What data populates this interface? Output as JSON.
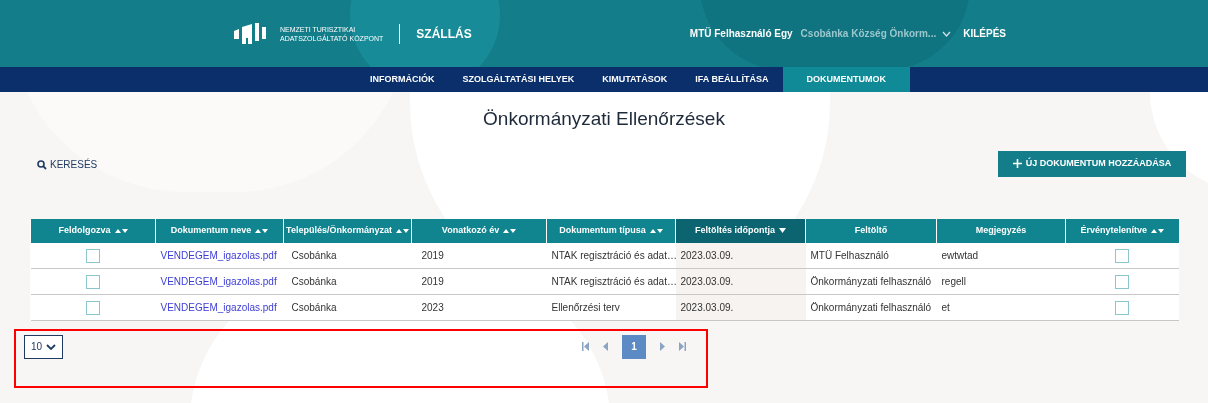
{
  "header": {
    "logo_line_1": "NEMZETI TURISZTIKAI",
    "logo_line_2": "ADATSZOLGÁLTATÓ KÖZPONT",
    "app_name": "SZÁLLÁS",
    "user": "MTÜ Felhasználó Egy",
    "organization": "Csobánka Község Önkorm...",
    "logout": "KILÉPÉS"
  },
  "nav": [
    {
      "label": "INFORMÁCIÓK",
      "selected": false
    },
    {
      "label": "SZOLGÁLTATÁSI HELYEK",
      "selected": false
    },
    {
      "label": "KIMUTATÁSOK",
      "selected": false
    },
    {
      "label": "IFA BEÁLLÍTÁSA",
      "selected": false
    },
    {
      "label": "DOKUMENTUMOK",
      "selected": true
    }
  ],
  "page_title": "Önkormányzati Ellenőrzések",
  "search_label": "KERESÉS",
  "add_button": "ÚJ DOKUMENTUM HOZZÁADÁSA",
  "table": {
    "columns": [
      {
        "label": "Feldolgozva",
        "sortable": true,
        "sorted": false
      },
      {
        "label": "Dokumentum neve",
        "sortable": true,
        "sorted": false
      },
      {
        "label": "Település/Önkormányzat",
        "sortable": true,
        "sorted": false
      },
      {
        "label": "Vonatkozó év",
        "sortable": true,
        "sorted": false
      },
      {
        "label": "Dokumentum típusa",
        "sortable": true,
        "sorted": false
      },
      {
        "label": "Feltöltés időpontja",
        "sortable": true,
        "sorted": true
      },
      {
        "label": "Feltöltő",
        "sortable": false,
        "sorted": false
      },
      {
        "label": "Megjegyzés",
        "sortable": false,
        "sorted": false
      },
      {
        "label": "Érvénytelenítve",
        "sortable": true,
        "sorted": false
      }
    ],
    "rows": [
      {
        "processed": false,
        "name": "VENDEGEM_igazolas.pdf",
        "municipality": "Csobánka",
        "year": "2019",
        "type": "NTAK regisztráció és adat…",
        "uploaded": "2023.03.09.",
        "uploader": "MTÜ Felhasználó",
        "note": "ewtwtad",
        "invalidated": false
      },
      {
        "processed": false,
        "name": "VENDEGEM_igazolas.pdf",
        "municipality": "Csobánka",
        "year": "2019",
        "type": "NTAK regisztráció és adat…",
        "uploaded": "2023.03.09.",
        "uploader": "Önkormányzati felhasználó",
        "note": "regell",
        "invalidated": false
      },
      {
        "processed": false,
        "name": "VENDEGEM_igazolas.pdf",
        "municipality": "Csobánka",
        "year": "2023",
        "type": "Ellenőrzési terv",
        "uploaded": "2023.03.09.",
        "uploader": "Önkormányzati felhasználó",
        "note": "et",
        "invalidated": false
      }
    ]
  },
  "pagination": {
    "page_size": "10",
    "pages": [
      {
        "label": "1",
        "selected": true
      }
    ]
  }
}
